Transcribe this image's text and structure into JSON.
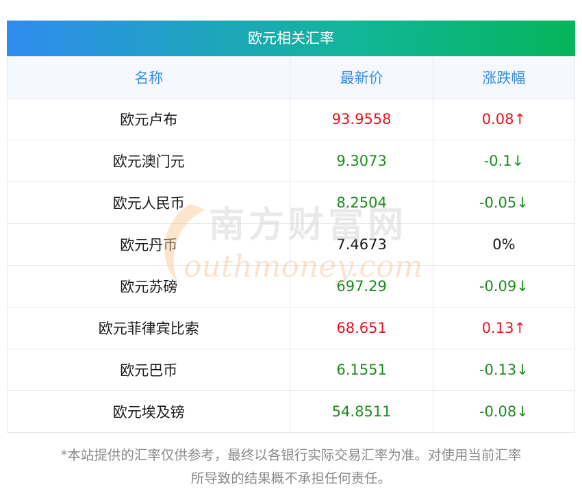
{
  "table": {
    "title": "欧元相关汇率",
    "columns": [
      "名称",
      "最新价",
      "涨跌幅"
    ],
    "rows": [
      {
        "name": "欧元卢布",
        "price": "93.9558",
        "change": "0.08↑",
        "trend": "up"
      },
      {
        "name": "欧元澳门元",
        "price": "9.3073",
        "change": "-0.1↓",
        "trend": "down"
      },
      {
        "name": "欧元人民币",
        "price": "8.2504",
        "change": "-0.05↓",
        "trend": "down"
      },
      {
        "name": "欧元丹币",
        "price": "7.4673",
        "change": "0%",
        "trend": "flat"
      },
      {
        "name": "欧元苏磅",
        "price": "697.29",
        "change": "-0.09↓",
        "trend": "down"
      },
      {
        "name": "欧元菲律宾比索",
        "price": "68.651",
        "change": "0.13↑",
        "trend": "up"
      },
      {
        "name": "欧元巴币",
        "price": "6.1551",
        "change": "-0.13↓",
        "trend": "down"
      },
      {
        "name": "欧元埃及镑",
        "price": "54.8511",
        "change": "-0.08↓",
        "trend": "down"
      }
    ]
  },
  "watermark": {
    "cn": "南方财富网",
    "en": "outhmoney.com"
  },
  "disclaimer": {
    "line1": "*本站提供的汇率仅供参考，最终以各银行实际交易汇率为准。对使用当前汇率",
    "line2": "所导致的结果概不承担任何责任。"
  },
  "colors": {
    "up": "#e8141b",
    "down": "#1c8c1c",
    "header_text": "#3a8ee6",
    "title_start": "#2f8cf0",
    "title_end": "#06b45a"
  }
}
